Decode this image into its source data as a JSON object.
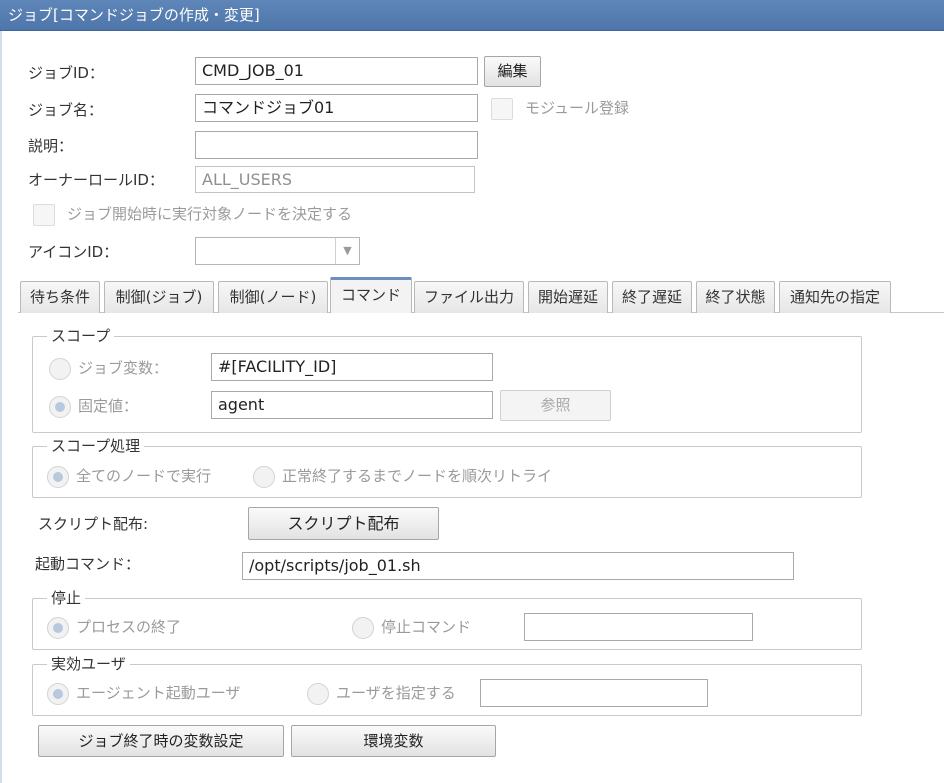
{
  "window": {
    "title": "ジョブ[コマンドジョブの作成・変更]"
  },
  "form": {
    "job_id_label": "ジョブID：",
    "job_id_value": "CMD_JOB_01",
    "edit_button": "編集",
    "job_name_label": "ジョブ名：",
    "job_name_value": "コマンドジョブ01",
    "module_register_label": "モジュール登録",
    "description_label": "説明：",
    "description_value": "",
    "owner_role_label": "オーナーロールID：",
    "owner_role_value": "ALL_USERS",
    "decide_node_label": "ジョブ開始時に実行対象ノードを決定する",
    "icon_id_label": "アイコンID：",
    "icon_id_value": ""
  },
  "tabs": [
    {
      "label": "待ち条件",
      "active": false
    },
    {
      "label": "制御(ジョブ)",
      "active": false
    },
    {
      "label": "制御(ノード)",
      "active": false
    },
    {
      "label": "コマンド",
      "active": true
    },
    {
      "label": "ファイル出力",
      "active": false
    },
    {
      "label": "開始遅延",
      "active": false
    },
    {
      "label": "終了遅延",
      "active": false
    },
    {
      "label": "終了状態",
      "active": false
    },
    {
      "label": "通知先の指定",
      "active": false
    }
  ],
  "command_tab": {
    "scope": {
      "title": "スコープ",
      "job_var_label": "ジョブ変数：",
      "job_var_value": "#[FACILITY_ID]",
      "fixed_label": "固定値：",
      "fixed_value": "agent",
      "ref_button": "参照"
    },
    "scope_proc": {
      "title": "スコープ処理",
      "all_nodes_label": "全てのノードで実行",
      "retry_label": "正常終了するまでノードを順次リトライ"
    },
    "script_dist_label": "スクリプト配布:",
    "script_dist_button": "スクリプト配布",
    "start_cmd_label": "起動コマンド：",
    "start_cmd_value": "/opt/scripts/job_01.sh",
    "stop": {
      "title": "停止",
      "process_end_label": "プロセスの終了",
      "stop_cmd_label": "停止コマンド",
      "stop_cmd_value": ""
    },
    "effective_user": {
      "title": "実効ユーザ",
      "agent_user_label": "エージェント起動ユーザ",
      "specify_user_label": "ユーザを指定する",
      "user_value": ""
    },
    "var_setting_button": "ジョブ終了時の変数設定",
    "env_var_button": "環境変数"
  }
}
